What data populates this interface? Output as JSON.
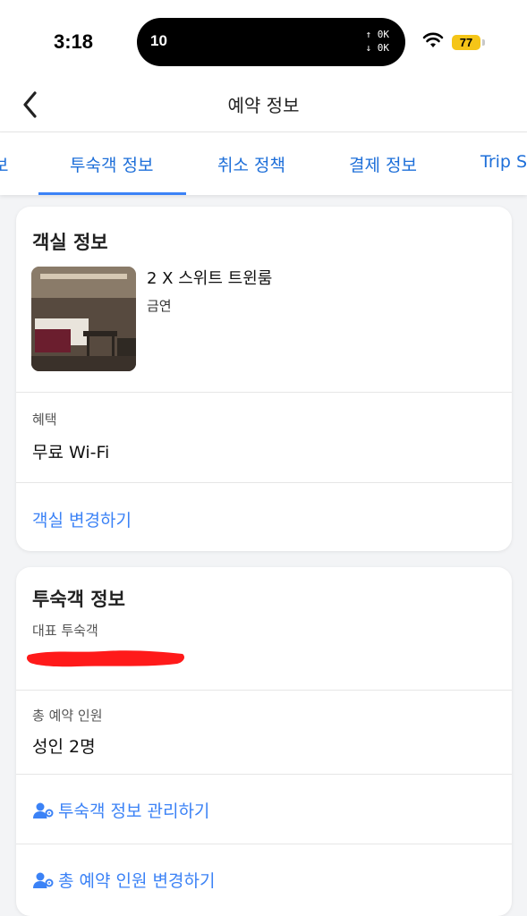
{
  "status_bar": {
    "time": "3:18",
    "island_number": "10",
    "net_up": "↑ 0K",
    "net_down": "↓ 0K",
    "battery": "77",
    "battery_color": "#f5c518"
  },
  "header": {
    "title": "예약 정보",
    "back_icon": "chevron-left-icon"
  },
  "tabs": [
    {
      "label": "보"
    },
    {
      "label": "투숙객 정보",
      "active": true
    },
    {
      "label": "취소 정책"
    },
    {
      "label": "결제 정보"
    },
    {
      "label": "Trip S"
    }
  ],
  "room_card": {
    "title": "객실 정보",
    "room_name": "2 X 스위트 트윈룸",
    "smoking": "금연",
    "benefit_label": "혜택",
    "benefit_value": "무료 Wi-Fi",
    "change_room_link": "객실 변경하기"
  },
  "guest_card": {
    "title": "투숙객 정보",
    "lead_guest_label": "대표 투숙객",
    "total_label": "총 예약 인원",
    "total_value": "성인 2명",
    "manage_link": "투숙객 정보 관리하기",
    "change_total_link": "총 예약 인원 변경하기",
    "link_icon": "user-gear-icon"
  },
  "colors": {
    "accent": "#3b82f6",
    "tab_text": "#1e6fd9",
    "redaction": "#ff1a1a"
  }
}
